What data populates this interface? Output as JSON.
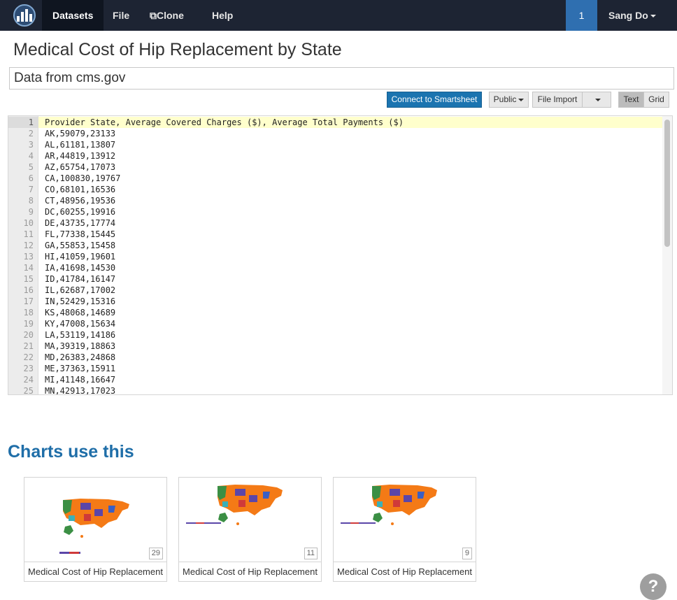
{
  "nav": {
    "datasets": "Datasets",
    "file": "File",
    "clone": "Clone",
    "help": "Help",
    "badge": "1",
    "user": "Sang Do"
  },
  "page": {
    "title": "Medical Cost of Hip Replacement by State",
    "description": "Data from cms.gov"
  },
  "toolbar": {
    "connect": "Connect to Smartsheet",
    "visibility": "Public",
    "file_import": "File Import",
    "text": "Text",
    "grid": "Grid"
  },
  "editor_lines": [
    "Provider State, Average Covered Charges ($), Average Total Payments ($)",
    "AK,59079,23133",
    "AL,61181,13807",
    "AR,44819,13912",
    "AZ,65754,17073",
    "CA,100830,19767",
    "CO,68101,16536",
    "CT,48956,19536",
    "DC,60255,19916",
    "DE,43735,17774",
    "FL,77338,15445",
    "GA,55853,15458",
    "HI,41059,19601",
    "IA,41698,14530",
    "ID,41784,16147",
    "IL,62687,17002",
    "IN,52429,15316",
    "KS,48068,14689",
    "KY,47008,15634",
    "LA,53119,14186",
    "MA,39319,18863",
    "MD,26383,24868",
    "ME,37363,15911",
    "MI,41148,16647",
    "MN,42913,17023"
  ],
  "charts": {
    "section_title": "Charts use this",
    "cards": [
      {
        "label": "Medical Cost of Hip Replacement",
        "count": "29"
      },
      {
        "label": "Medical Cost of Hip Replacement",
        "count": "11"
      },
      {
        "label": "Medical Cost of Hip Replacement",
        "count": "9"
      }
    ]
  },
  "help_icon": "?",
  "colors": {
    "navbar": "#1d2433",
    "accent": "#1b74b0",
    "active_line": "#ffffcc"
  }
}
